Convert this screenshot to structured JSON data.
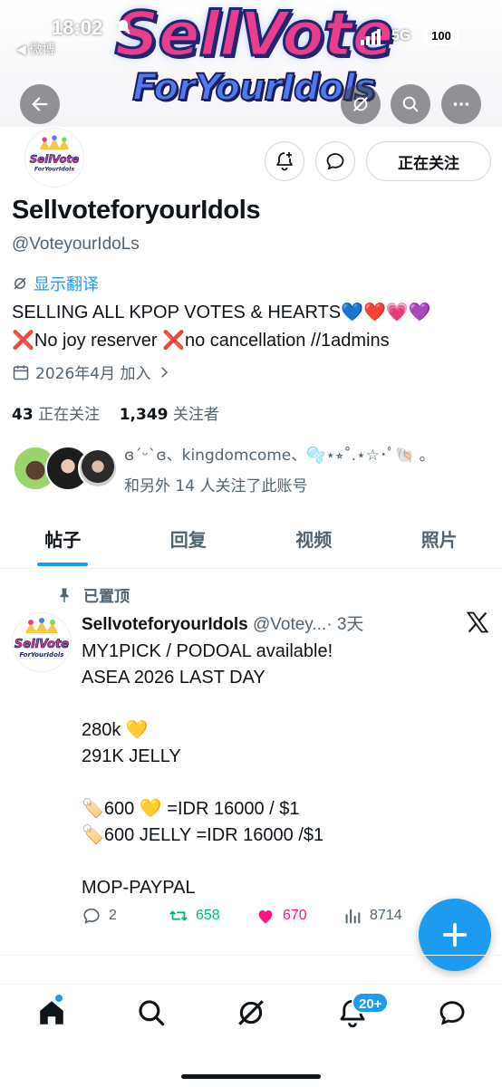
{
  "status_bar": {
    "time": "18:02",
    "back_app": "◀ 微博",
    "network": "5G",
    "battery": "100"
  },
  "banner": {
    "line1": "SellVote",
    "line2": "ForYourIdols"
  },
  "profile": {
    "avatar_logo_line1": "SellVote",
    "avatar_logo_line2": "ForYourIdols",
    "display_name": "SellvoteforyourIdols",
    "handle": "@VoteyourIdoLs",
    "translate_label": "显示翻译",
    "bio_line1": "SELLING ALL KPOP VOTES & HEARTS💙❤️💗💜",
    "bio_line2": "❌No joy reserver ❌no cancellation //1admins",
    "joined": "2026年4月 加入",
    "following_count": "43",
    "following_label": "正在关注",
    "followers_count": "1,349",
    "followers_label": "关注者",
    "followed_by_line1": "ɞ´ᵕ`ɞ、kingdomcome、🫧⋆⭒˚.⋆☆･ﾟ🐚 。",
    "followed_by_line2": "和另外 14 人关注了此账号",
    "follow_button": "正在关注"
  },
  "tabs": [
    {
      "label": "帖子",
      "active": true
    },
    {
      "label": "回复",
      "active": false
    },
    {
      "label": "视频",
      "active": false
    },
    {
      "label": "照片",
      "active": false
    }
  ],
  "tweet": {
    "pinned_label": "已置顶",
    "name": "SellvoteforyourIdols",
    "handle": "@Votey...",
    "time": "· 3天",
    "body": "MY1PICK / PODOAL available!\nASEA 2026 LAST DAY\n\n280k 💛\n291K JELLY\n\n🏷️600 💛  =IDR 16000 / $1\n🏷️600 JELLY =IDR 16000 /$1\n\nMOP-PAYPAL",
    "replies": "2",
    "reposts": "658",
    "likes": "670",
    "views": "8714"
  },
  "bottom_nav": {
    "notifications_badge": "20+"
  },
  "colors": {
    "accent": "#1d9bf0",
    "repost": "#00ba7c",
    "like": "#f91880",
    "text_secondary": "#536471"
  }
}
